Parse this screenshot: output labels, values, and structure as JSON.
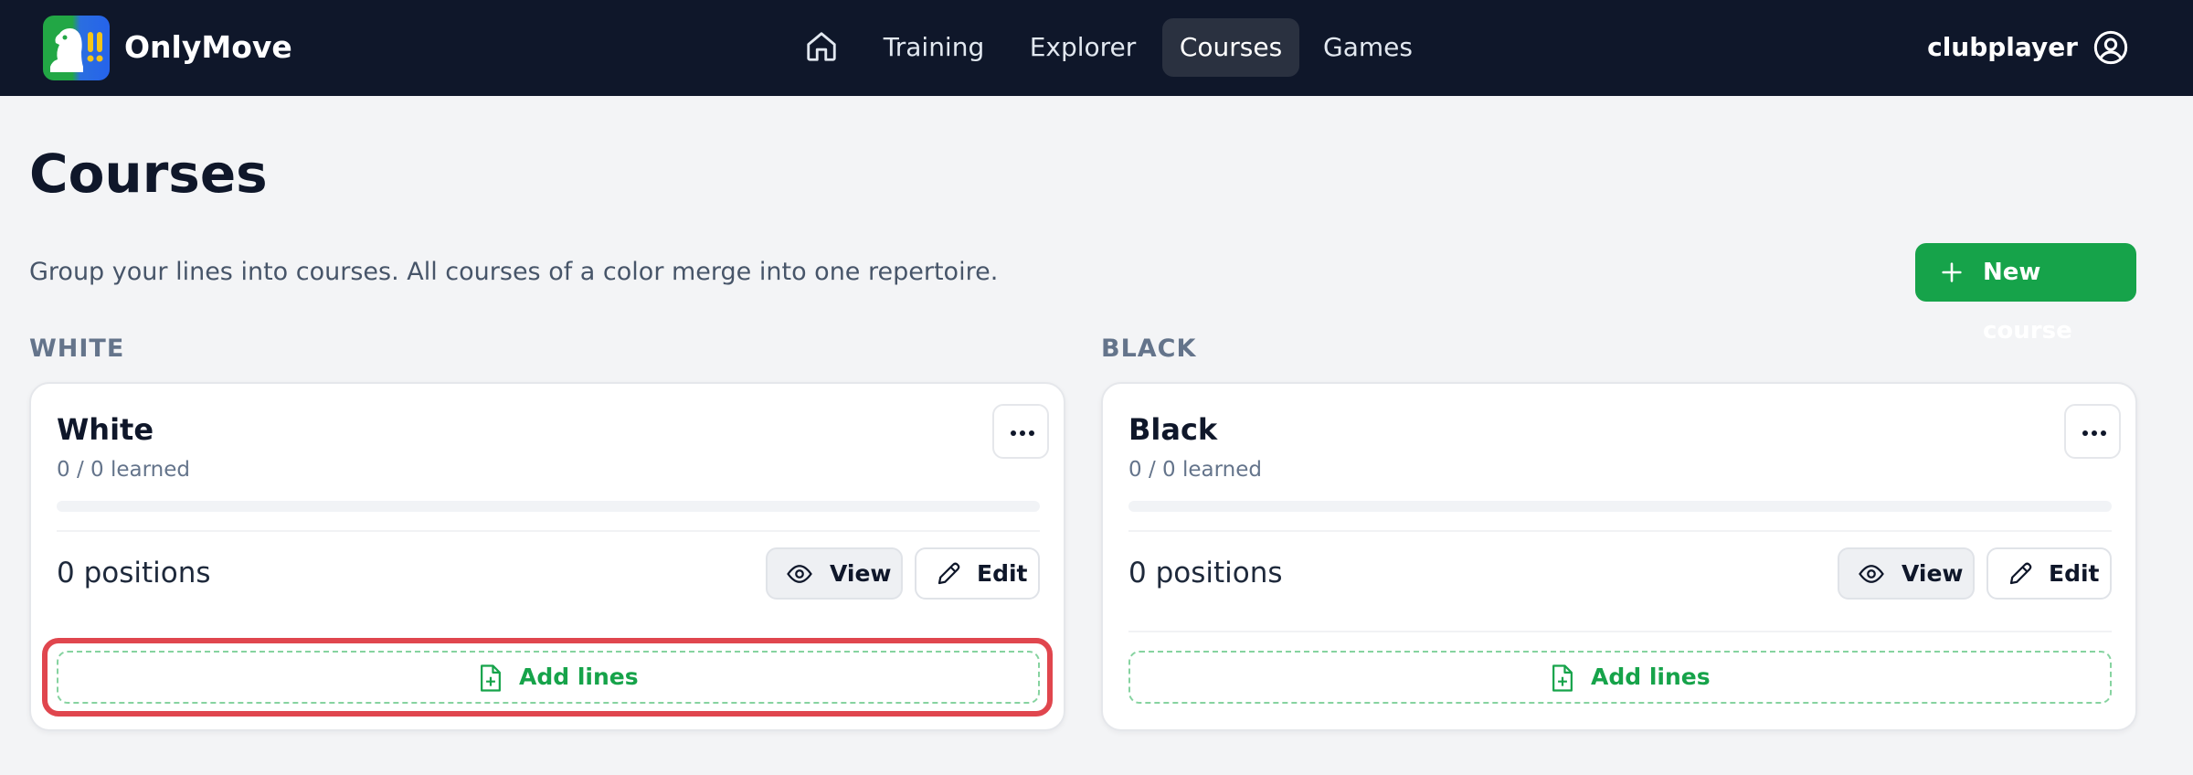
{
  "app": {
    "name": "OnlyMove"
  },
  "nav": {
    "home_icon": "home-icon",
    "items": [
      {
        "label": "Training"
      },
      {
        "label": "Explorer"
      },
      {
        "label": "Courses",
        "active": true
      },
      {
        "label": "Games"
      }
    ],
    "user": {
      "name": "clubplayer",
      "icon": "user-circle-icon"
    }
  },
  "page": {
    "title": "Courses",
    "subtitle": "Group your lines into courses. All courses of a color merge into one repertoire.",
    "new_course_label": "New course"
  },
  "sections": [
    {
      "label": "WHITE",
      "card": {
        "title": "White",
        "learned": "0 / 0 learned",
        "progress": 0,
        "positions": "0 positions",
        "view_label": "View",
        "edit_label": "Edit",
        "add_lines_label": "Add lines"
      }
    },
    {
      "label": "BLACK",
      "card": {
        "title": "Black",
        "learned": "0 / 0 learned",
        "progress": 0,
        "positions": "0 positions",
        "view_label": "View",
        "edit_label": "Edit",
        "add_lines_label": "Add lines"
      }
    }
  ],
  "colors": {
    "nav_bg": "#0f172a",
    "accent_green": "#16a34a",
    "highlight_red": "#e0464e",
    "page_bg": "#f3f4f6"
  }
}
